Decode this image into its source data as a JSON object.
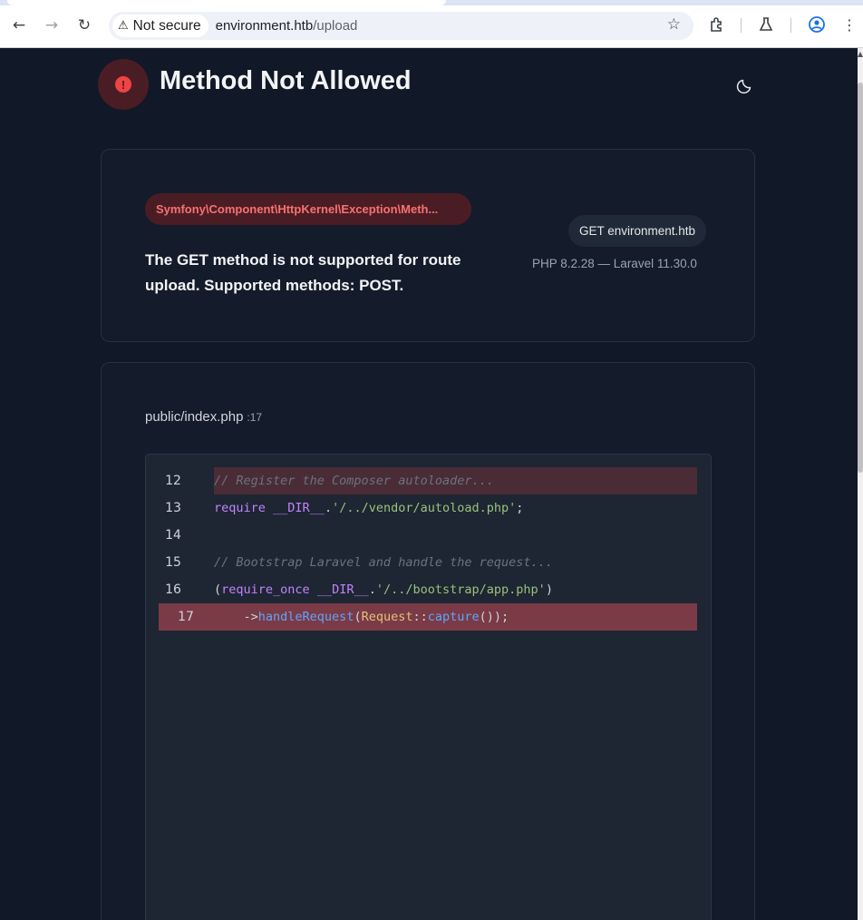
{
  "browser": {
    "security_label": "Not secure",
    "url_host": "environment.htb",
    "url_path": "/upload"
  },
  "header": {
    "title": "Method Not Allowed"
  },
  "summary": {
    "exception_class": "Symfony\\Component\\HttpKernel\\Exception\\Meth...",
    "message": "The GET method is not supported for route upload. Supported methods: POST.",
    "request": "GET environment.htb",
    "versions": "PHP 8.2.28 — Laravel 11.30.0"
  },
  "frame": {
    "file": "public/index.php",
    "line": ":17"
  },
  "code": {
    "lines": [
      {
        "n": "12"
      },
      {
        "n": "13"
      },
      {
        "n": "14"
      },
      {
        "n": "15"
      },
      {
        "n": "16"
      },
      {
        "n": "17"
      }
    ],
    "l12": "// Register the Composer autoloader...",
    "l13_kw": "require",
    "l13_const": "__DIR__",
    "l13_dot": ".",
    "l13_str": "'/../vendor/autoload.php'",
    "l13_end": ";",
    "l15": "// Bootstrap Laravel and handle the request...",
    "l16_open": "(",
    "l16_kw": "require_once",
    "l16_const": "__DIR__",
    "l16_dot": ".",
    "l16_str": "'/../bootstrap/app.php'",
    "l16_close": ")",
    "l17_arrow": "    ->",
    "l17_fn": "handleRequest",
    "l17_p1": "(",
    "l17_cls": "Request",
    "l17_sep": "::",
    "l17_fn2": "capture",
    "l17_end": "());"
  }
}
